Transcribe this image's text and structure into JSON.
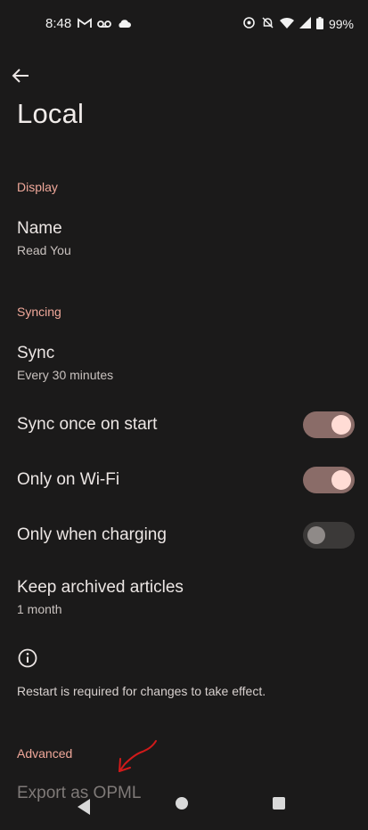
{
  "status_bar": {
    "time": "8:48",
    "left_icons": [
      "gmail-icon",
      "voicemail-icon",
      "cloud-icon"
    ],
    "right_icons": [
      "location-target-icon",
      "do-not-disturb-off-icon",
      "wifi-icon",
      "signal-icon",
      "battery-icon"
    ],
    "battery": "99%"
  },
  "app_bar": {
    "back_icon": "arrow-back-icon",
    "title": "Local"
  },
  "sections": {
    "display": {
      "header": "Display",
      "name": {
        "title": "Name",
        "subtitle": "Read You"
      }
    },
    "syncing": {
      "header": "Syncing",
      "sync": {
        "title": "Sync",
        "subtitle": "Every 30 minutes"
      },
      "sync_once_on_start": {
        "title": "Sync once on start",
        "enabled": true
      },
      "only_on_wifi": {
        "title": "Only on Wi-Fi",
        "enabled": true
      },
      "only_when_charging": {
        "title": "Only when charging",
        "enabled": false
      },
      "keep_archived": {
        "title": "Keep archived articles",
        "subtitle": "1 month"
      },
      "info": {
        "icon": "info-icon",
        "text": "Restart is required for changes to take effect."
      }
    },
    "advanced": {
      "header": "Advanced",
      "export": {
        "title": "Export as OPML"
      }
    }
  },
  "colors": {
    "background": "#1b1a1a",
    "accent_header": "#f0a89a",
    "toggle_on_track": "#8a6c68",
    "toggle_on_knob": "#ffdcd5",
    "toggle_off_track": "#3b3938",
    "annotation_arrow": "#d11a1a"
  },
  "nav_bar": {
    "icons": [
      "nav-back-icon",
      "nav-home-icon",
      "nav-recents-icon"
    ]
  }
}
